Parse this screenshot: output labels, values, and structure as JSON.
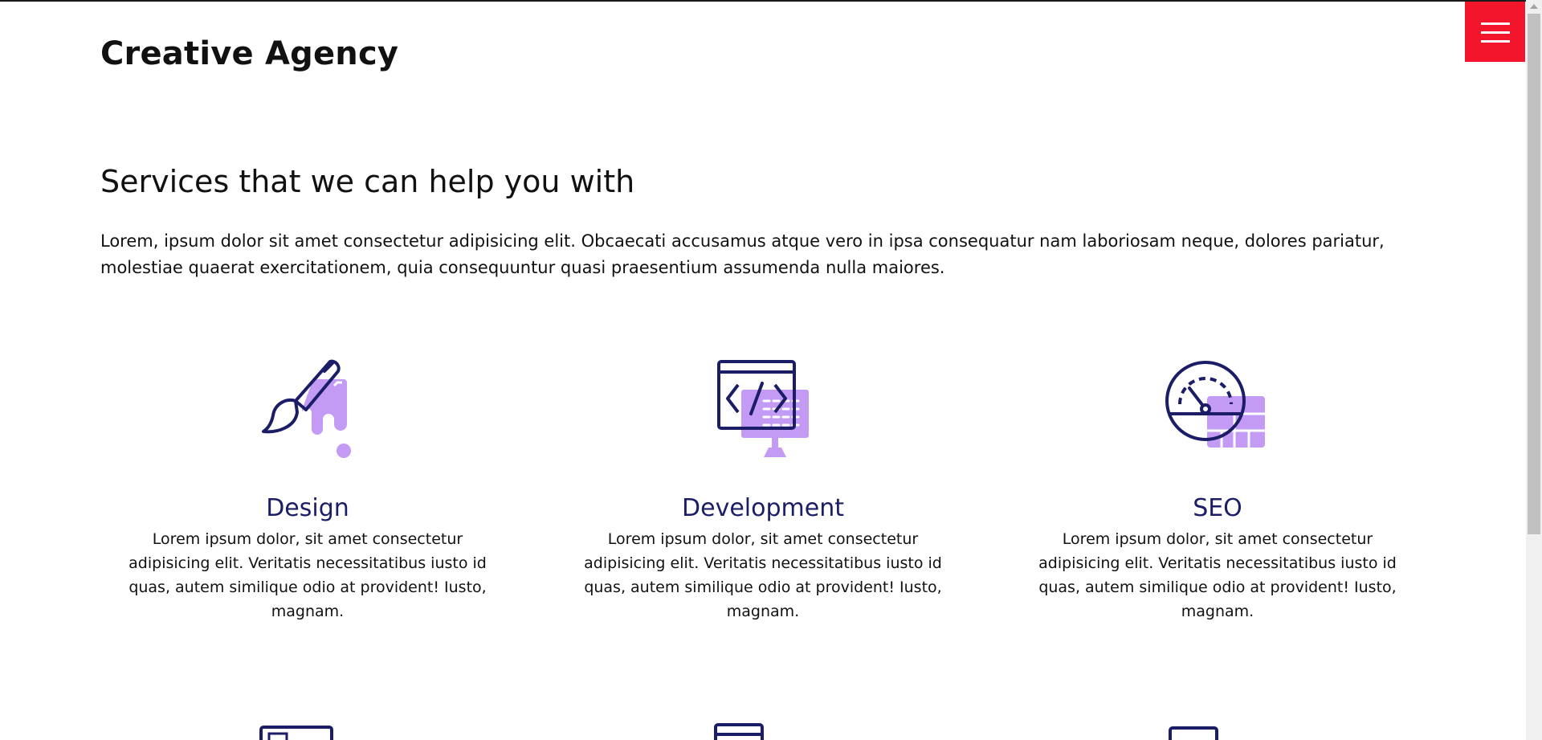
{
  "header": {
    "brand": "Creative Agency",
    "menu_icon": "hamburger-menu-icon",
    "menu_color": "#f3152c"
  },
  "services_section": {
    "title": "Services that we can help you with",
    "intro": "Lorem, ipsum dolor sit amet consectetur adipisicing elit. Obcaecati accusamus atque vero in ipsa consequatur nam laboriosam neque, dolores pariatur, molestiae quaerat exercitationem, quia consequuntur quasi praesentium assumenda nulla maiores.",
    "items": [
      {
        "icon": "paint-brush-icon",
        "title": "Design",
        "text": "Lorem ipsum dolor, sit amet consectetur adipisicing elit. Veritatis necessitatibus iusto id quas, autem similique odio at provident! Iusto, magnam."
      },
      {
        "icon": "code-monitor-icon",
        "title": "Development",
        "text": "Lorem ipsum dolor, sit amet consectetur adipisicing elit. Veritatis necessitatibus iusto id quas, autem similique odio at provident! Iusto, magnam."
      },
      {
        "icon": "speedometer-icon",
        "title": "SEO",
        "text": "Lorem ipsum dolor, sit amet consectetur adipisicing elit. Veritatis necessitatibus iusto id quas, autem similique odio at provident! Iusto, magnam."
      }
    ]
  },
  "colors": {
    "accent": "#f3152c",
    "icon_stroke": "#1b1e66",
    "icon_fill": "#c39bf5",
    "service_title": "#1b1e66"
  }
}
